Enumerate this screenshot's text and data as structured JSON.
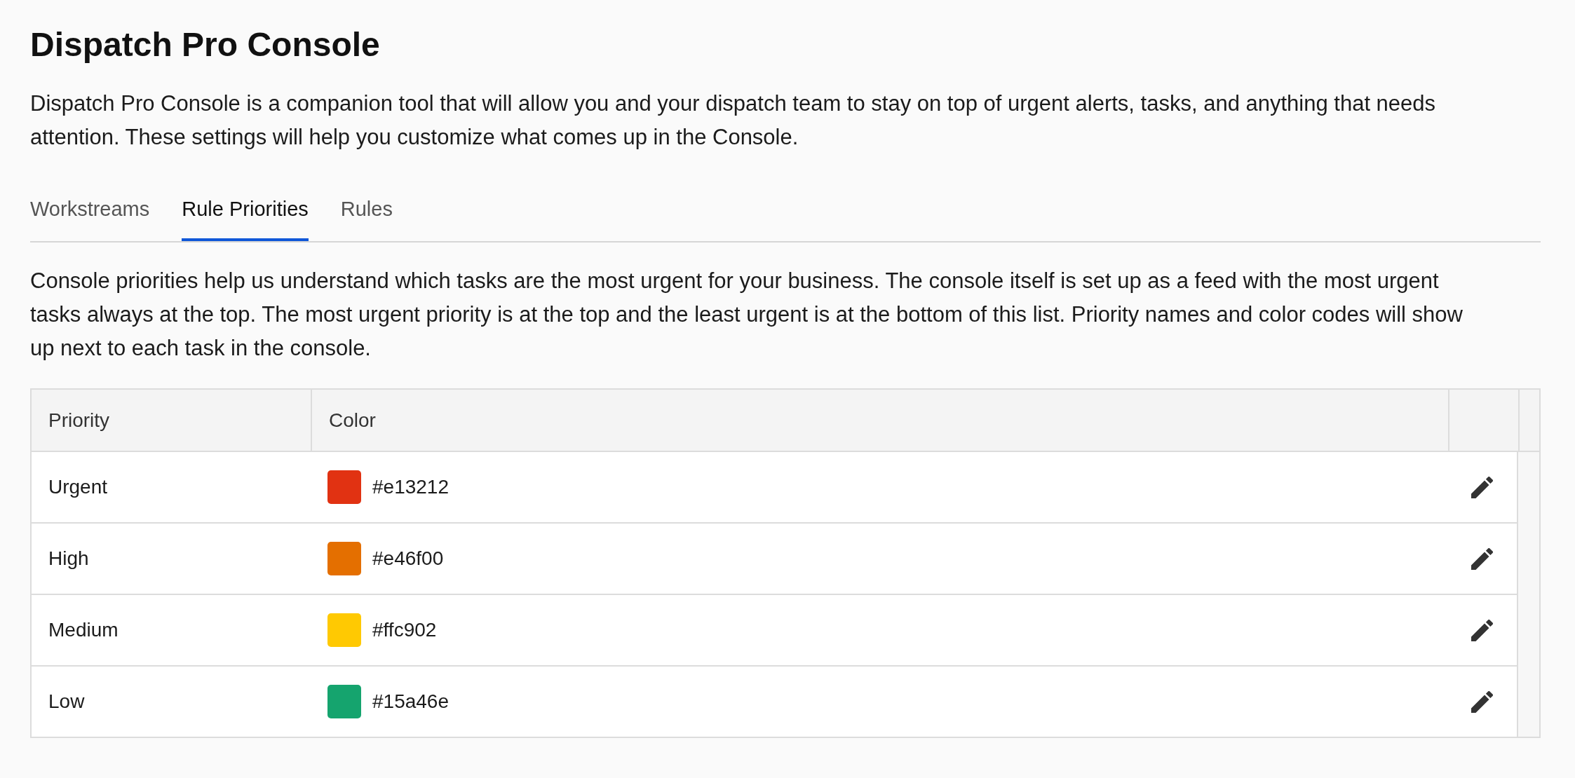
{
  "page": {
    "title": "Dispatch Pro Console",
    "intro": "Dispatch Pro Console is a companion tool that will allow you and your dispatch team to stay on top of urgent alerts, tasks, and anything that needs attention. These settings will help you customize what comes up in the Console."
  },
  "tabs": [
    {
      "label": "Workstreams",
      "selected": false
    },
    {
      "label": "Rule Priorities",
      "selected": true
    },
    {
      "label": "Rules",
      "selected": false
    }
  ],
  "description": "Console priorities help us understand which tasks are the most urgent for your business. The console itself is set up as a feed with the most urgent tasks always at the top. The most urgent priority is at the top and the least urgent is at the bottom of this list. Priority names and color codes will show up next to each task in the console.",
  "table": {
    "columns": [
      "Priority",
      "Color"
    ],
    "rows": [
      {
        "priority": "Urgent",
        "color": "#e13212",
        "code": "#e13212"
      },
      {
        "priority": "High",
        "color": "#e46f00",
        "code": "#e46f00"
      },
      {
        "priority": "Medium",
        "color": "#ffc902",
        "code": "#ffc902"
      },
      {
        "priority": "Low",
        "color": "#15a46e",
        "code": "#15a46e"
      }
    ]
  }
}
